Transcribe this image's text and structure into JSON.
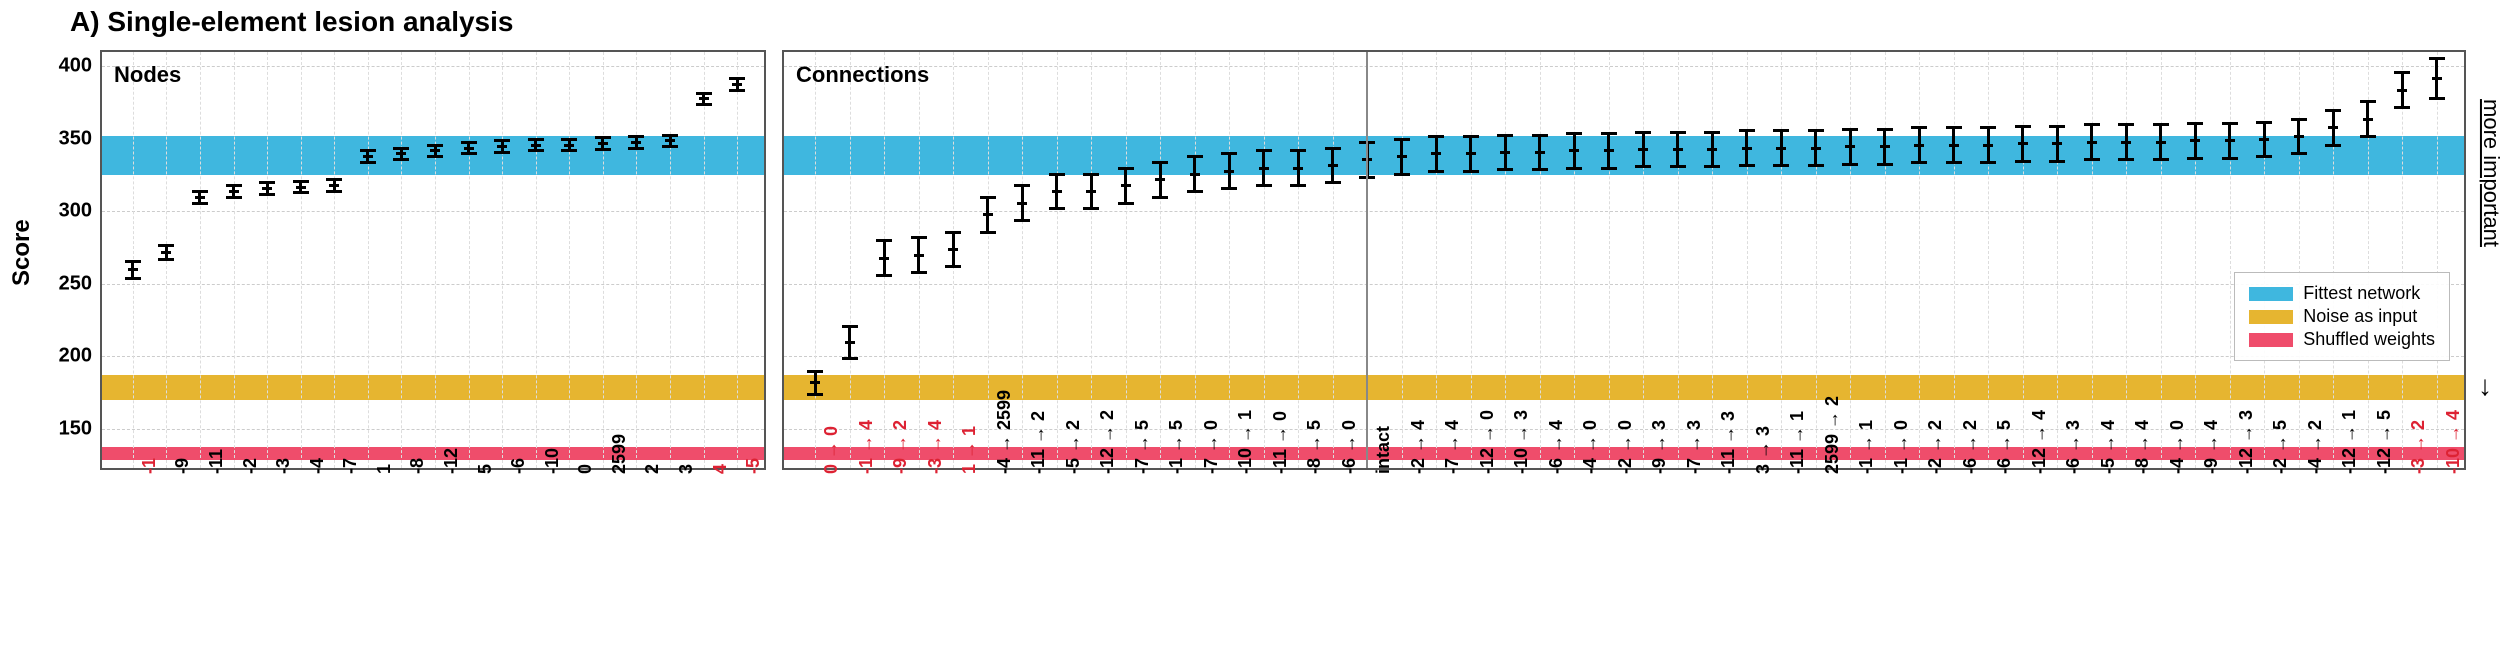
{
  "chart_data": {
    "type": "scatter",
    "title": "A) Single-element lesion analysis",
    "ylabel": "Score",
    "side_label": "more important",
    "ylim": [
      120,
      410
    ],
    "yticks": [
      150,
      200,
      250,
      300,
      350,
      400
    ],
    "bands": {
      "fittest_network": {
        "label": "Fittest network",
        "color": "#3fb7df",
        "ymin": 325,
        "ymax": 352
      },
      "noise_as_input": {
        "label": "Noise as input",
        "color": "#e6b530",
        "ymin": 170,
        "ymax": 187
      },
      "shuffled_weights": {
        "label": "Shuffled weights",
        "color": "#ef4d6b",
        "ymin": 128,
        "ymax": 137
      }
    },
    "panels": [
      {
        "name": "Nodes",
        "x": [
          {
            "label": "-1",
            "special": true,
            "y": 260,
            "err": 6
          },
          {
            "label": "-9",
            "special": false,
            "y": 272,
            "err": 5
          },
          {
            "label": "-11",
            "special": false,
            "y": 310,
            "err": 4
          },
          {
            "label": "-2",
            "special": false,
            "y": 314,
            "err": 4
          },
          {
            "label": "-3",
            "special": false,
            "y": 316,
            "err": 4
          },
          {
            "label": "-4",
            "special": false,
            "y": 317,
            "err": 4
          },
          {
            "label": "-7",
            "special": false,
            "y": 318,
            "err": 4
          },
          {
            "label": "1",
            "special": false,
            "y": 338,
            "err": 4
          },
          {
            "label": "-8",
            "special": false,
            "y": 340,
            "err": 4
          },
          {
            "label": "-12",
            "special": false,
            "y": 342,
            "err": 4
          },
          {
            "label": "5",
            "special": false,
            "y": 344,
            "err": 4
          },
          {
            "label": "-6",
            "special": false,
            "y": 345,
            "err": 4
          },
          {
            "label": "-10",
            "special": false,
            "y": 346,
            "err": 4
          },
          {
            "label": "0",
            "special": false,
            "y": 346,
            "err": 4
          },
          {
            "label": "2599",
            "special": false,
            "y": 347,
            "err": 4
          },
          {
            "label": "2",
            "special": false,
            "y": 348,
            "err": 4
          },
          {
            "label": "3",
            "special": false,
            "y": 349,
            "err": 4
          },
          {
            "label": "4",
            "special": true,
            "y": 378,
            "err": 4
          },
          {
            "label": "-5",
            "special": true,
            "y": 388,
            "err": 4
          }
        ]
      },
      {
        "name": "Connections",
        "x": [
          {
            "label": "0 → 0",
            "special": true,
            "y": 182,
            "err": 8
          },
          {
            "label": "-1 → 4",
            "special": true,
            "y": 210,
            "err": 11
          },
          {
            "label": "-9 → 2",
            "special": true,
            "y": 268,
            "err": 12
          },
          {
            "label": "-3 → 4",
            "special": true,
            "y": 270,
            "err": 12
          },
          {
            "label": "1 → 1",
            "special": true,
            "y": 274,
            "err": 12
          },
          {
            "label": "-4 → 2599",
            "special": false,
            "y": 298,
            "err": 12
          },
          {
            "label": "-11 → 2",
            "special": false,
            "y": 306,
            "err": 12
          },
          {
            "label": "-5 → 2",
            "special": false,
            "y": 314,
            "err": 12
          },
          {
            "label": "-12 → 2",
            "special": false,
            "y": 314,
            "err": 12
          },
          {
            "label": "-7 → 5",
            "special": false,
            "y": 318,
            "err": 12
          },
          {
            "label": "-1 → 5",
            "special": false,
            "y": 322,
            "err": 12
          },
          {
            "label": "-7 → 0",
            "special": false,
            "y": 326,
            "err": 12
          },
          {
            "label": "-10 → 1",
            "special": false,
            "y": 328,
            "err": 12
          },
          {
            "label": "-11 → 0",
            "special": false,
            "y": 330,
            "err": 12
          },
          {
            "label": "-8 → 5",
            "special": false,
            "y": 330,
            "err": 12
          },
          {
            "label": "-6 → 0",
            "special": false,
            "y": 332,
            "err": 12
          },
          {
            "label": "intact",
            "special": false,
            "y": 336,
            "err": 12,
            "intact": true
          },
          {
            "label": "-2 → 4",
            "special": false,
            "y": 338,
            "err": 12
          },
          {
            "label": "-7 → 4",
            "special": false,
            "y": 340,
            "err": 12
          },
          {
            "label": "-12 → 0",
            "special": false,
            "y": 340,
            "err": 12
          },
          {
            "label": "-10 → 3",
            "special": false,
            "y": 341,
            "err": 12
          },
          {
            "label": "-6 → 4",
            "special": false,
            "y": 341,
            "err": 12
          },
          {
            "label": "-4 → 0",
            "special": false,
            "y": 342,
            "err": 12
          },
          {
            "label": "-2 → 0",
            "special": false,
            "y": 342,
            "err": 12
          },
          {
            "label": "-9 → 3",
            "special": false,
            "y": 343,
            "err": 12
          },
          {
            "label": "-7 → 3",
            "special": false,
            "y": 343,
            "err": 12
          },
          {
            "label": "-11 → 3",
            "special": false,
            "y": 343,
            "err": 12
          },
          {
            "label": "3 → 3",
            "special": false,
            "y": 344,
            "err": 12
          },
          {
            "label": "-11 → 1",
            "special": false,
            "y": 344,
            "err": 12
          },
          {
            "label": "2599 → 2",
            "special": false,
            "y": 344,
            "err": 12
          },
          {
            "label": "-1 → 1",
            "special": false,
            "y": 345,
            "err": 12
          },
          {
            "label": "-1 → 0",
            "special": false,
            "y": 345,
            "err": 12
          },
          {
            "label": "-2 → 2",
            "special": false,
            "y": 346,
            "err": 12
          },
          {
            "label": "-6 → 2",
            "special": false,
            "y": 346,
            "err": 12
          },
          {
            "label": "-6 → 5",
            "special": false,
            "y": 346,
            "err": 12
          },
          {
            "label": "-12 → 4",
            "special": false,
            "y": 347,
            "err": 12
          },
          {
            "label": "-6 → 3",
            "special": false,
            "y": 347,
            "err": 12
          },
          {
            "label": "-5 → 4",
            "special": false,
            "y": 348,
            "err": 12
          },
          {
            "label": "-8 → 4",
            "special": false,
            "y": 348,
            "err": 12
          },
          {
            "label": "-4 → 0",
            "special": false,
            "y": 348,
            "err": 12
          },
          {
            "label": "-9 → 4",
            "special": false,
            "y": 349,
            "err": 12
          },
          {
            "label": "-12 → 3",
            "special": false,
            "y": 349,
            "err": 12
          },
          {
            "label": "-2 → 5",
            "special": false,
            "y": 350,
            "err": 12
          },
          {
            "label": "-4 → 2",
            "special": false,
            "y": 352,
            "err": 12
          },
          {
            "label": "-12 → 1",
            "special": false,
            "y": 358,
            "err": 12
          },
          {
            "label": "-12 → 5",
            "special": false,
            "y": 364,
            "err": 12
          },
          {
            "label": "-3 → 2",
            "special": true,
            "y": 384,
            "err": 12
          },
          {
            "label": "-10 → 4",
            "special": true,
            "y": 392,
            "err": 14
          }
        ]
      }
    ]
  }
}
